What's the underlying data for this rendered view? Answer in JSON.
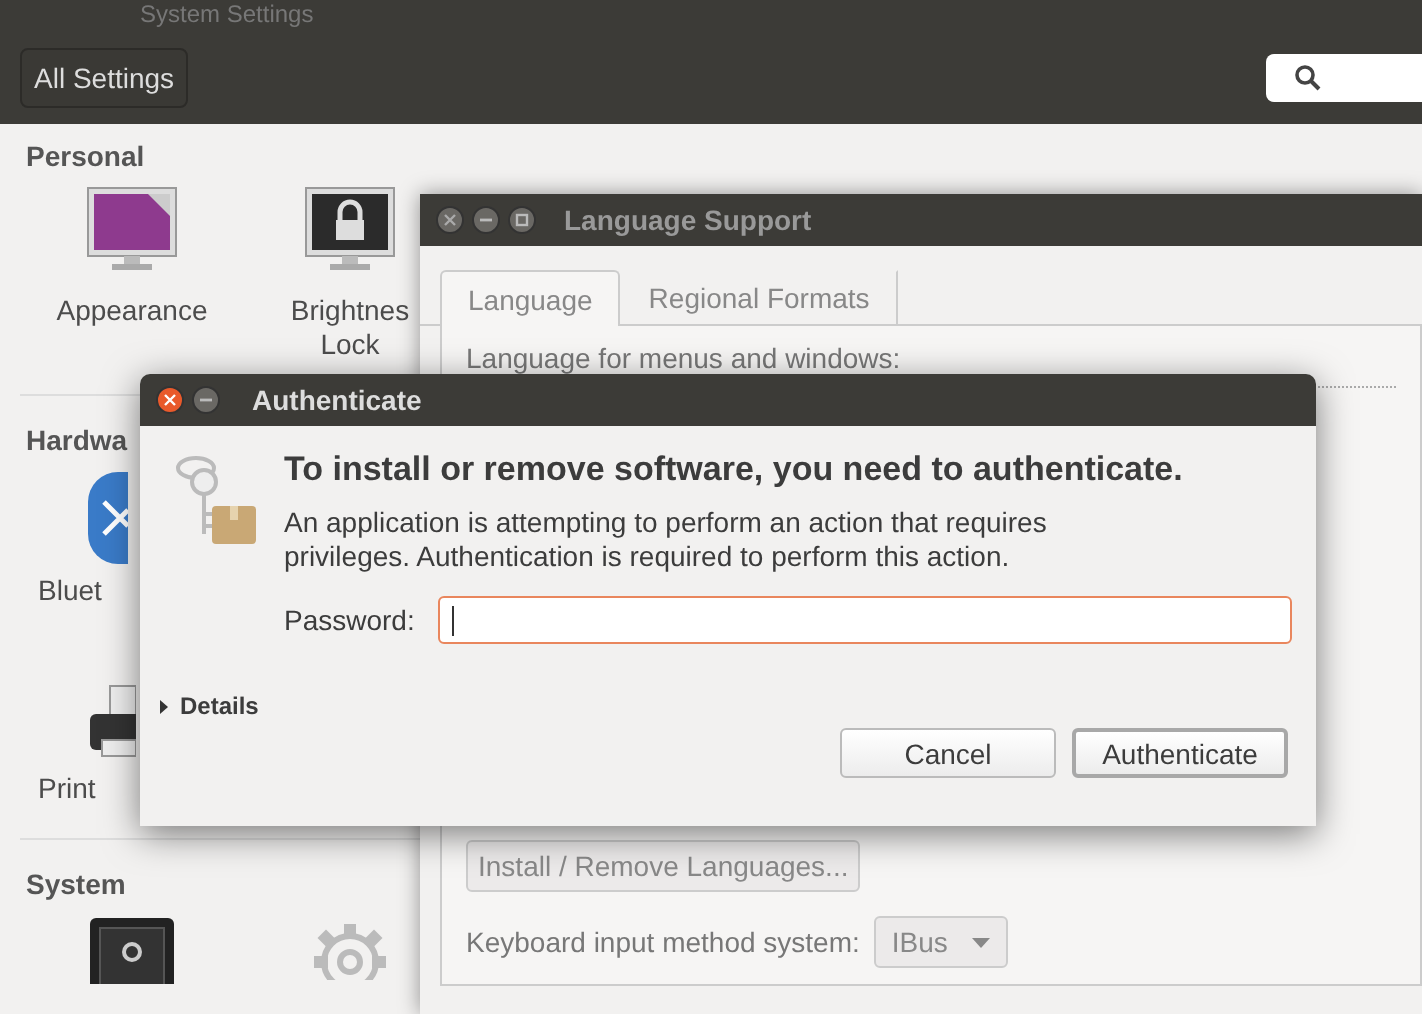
{
  "settings_window": {
    "title": "System Settings",
    "toolbar_button": "All Settings",
    "sections": [
      {
        "heading": "Personal",
        "items": [
          {
            "kind": "appearance",
            "lines": [
              "Appearance"
            ]
          },
          {
            "kind": "lock",
            "lines": [
              "Brightnes",
              "Lock"
            ]
          }
        ]
      },
      {
        "heading": "Hardwa",
        "items": [
          {
            "kind": "bluetooth",
            "lines": [
              "Bluet"
            ]
          },
          {
            "kind": "printer",
            "lines": [
              "Print"
            ]
          }
        ]
      },
      {
        "heading": "System",
        "items": [
          {
            "kind": "safe"
          },
          {
            "kind": "gear"
          }
        ]
      }
    ]
  },
  "language_window": {
    "title": "Language Support",
    "tabs": [
      {
        "label": "Language",
        "selected": true
      },
      {
        "label": "Regional Formats",
        "selected": false
      }
    ],
    "list_label": "Language for menus and windows:",
    "install_button": {
      "label": "Install / Remove Languages...",
      "disabled": true
    },
    "input_method": {
      "label": "Keyboard input method system:",
      "value": "IBus"
    }
  },
  "auth_dialog": {
    "title": "Authenticate",
    "heading": "To install or remove software, you need to authenticate.",
    "message": "An application is attempting to perform an action that requires privileges. Authentication is required to perform this action.",
    "password_label": "Password:",
    "password_focused": true,
    "details": {
      "label": "Details",
      "expanded": false
    },
    "buttons": [
      {
        "label": "Cancel",
        "default": false
      },
      {
        "label": "Authenticate",
        "default": true
      }
    ]
  }
}
